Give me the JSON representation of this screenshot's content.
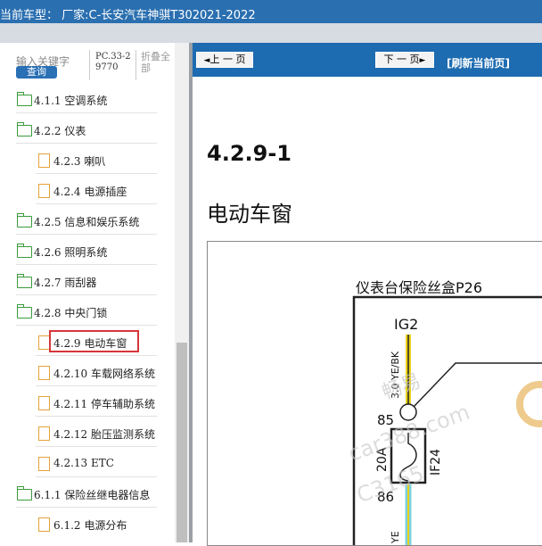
{
  "header": {
    "title": "当前车型：  厂家:C-长安汽车神骐T302021-2022"
  },
  "search": {
    "placeholder": "输入关键字",
    "query_label": "查询",
    "pc_code": "PC.33-29770",
    "fold_label": "折叠全部"
  },
  "tree": {
    "items": [
      {
        "label": "4.1.1 空调系统",
        "kind": "folder"
      },
      {
        "label": "4.2.2 仪表",
        "kind": "folder"
      },
      {
        "label": "4.2.3 喇叭",
        "kind": "doc"
      },
      {
        "label": "4.2.4 电源插座",
        "kind": "doc"
      },
      {
        "label": "4.2.5 信息和娱乐系统",
        "kind": "folder"
      },
      {
        "label": "4.2.6 照明系统",
        "kind": "folder"
      },
      {
        "label": "4.2.7 雨刮器",
        "kind": "folder"
      },
      {
        "label": "4.2.8 中央门锁",
        "kind": "folder"
      },
      {
        "label": "4.2.9 电动车窗",
        "kind": "doc",
        "selected": true
      },
      {
        "label": "4.2.10 车载网络系统",
        "kind": "doc"
      },
      {
        "label": "4.2.11 停车辅助系统",
        "kind": "doc"
      },
      {
        "label": "4.2.12 胎压监测系统",
        "kind": "doc"
      },
      {
        "label": "4.2.13 ETC",
        "kind": "doc"
      },
      {
        "label": "6.1.1 保险丝继电器信息",
        "kind": "folder"
      },
      {
        "label": "6.1.2 电源分布",
        "kind": "doc"
      }
    ]
  },
  "nav": {
    "prev_label": "上 一 页",
    "next_label": "下 一 页",
    "refresh_label": "[刷新当前页]"
  },
  "document": {
    "section": "4.2.9-1",
    "title": "电动车窗",
    "diagram": {
      "fusebox_label": "仪表台保险丝盒P26",
      "power": "IG2",
      "wire_top": "3.0 YE/BK",
      "fuse_rating": "20A",
      "fuse_id": "IF24",
      "pin_in": "85",
      "pin_out": "86",
      "wire_bottom": "YE"
    },
    "watermark": [
      "畅易",
      "car388.com",
      "C3165"
    ]
  },
  "colors": {
    "accent": "#1d6bb0",
    "selected_border": "#d4363a",
    "folder": "#3a9a3a",
    "doc": "#e5a23a"
  }
}
